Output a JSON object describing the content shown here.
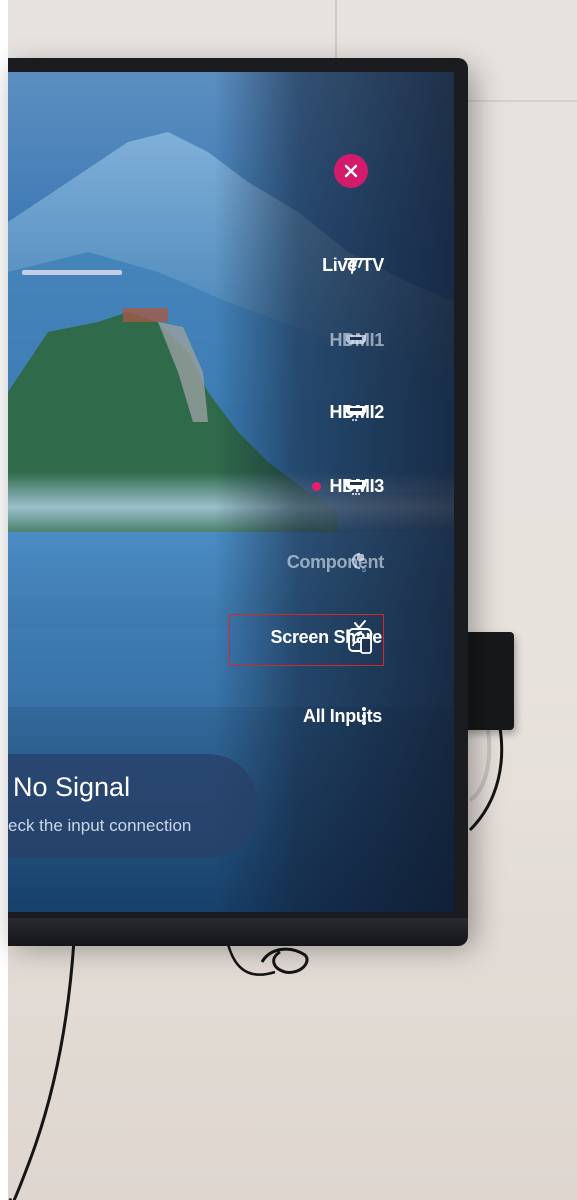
{
  "input_menu": {
    "close_label": "close",
    "items": [
      {
        "label": "Live TV",
        "icon": "antenna-icon",
        "active": false,
        "dimmed": false
      },
      {
        "label": "HDMI1",
        "icon": "hdmi-icon",
        "active": false,
        "dimmed": true
      },
      {
        "label": "HDMI2",
        "icon": "hdmi-icon",
        "active": false,
        "dimmed": false
      },
      {
        "label": "HDMI3",
        "icon": "hdmi-icon",
        "active": true,
        "dimmed": false
      },
      {
        "label": "Component",
        "icon": "component-icon",
        "active": false,
        "dimmed": true
      },
      {
        "label": "Screen Share",
        "icon": "screen-share-icon",
        "active": false,
        "dimmed": false,
        "highlighted": true
      },
      {
        "label": "All Inputs",
        "icon": "more-vertical-icon",
        "active": false,
        "dimmed": false
      }
    ]
  },
  "no_signal": {
    "title": "No Signal",
    "subtitle": "eck the input connection"
  },
  "colors": {
    "accent": "#d31b6b",
    "active_dot": "#e8206c",
    "highlight_box": "#d6252b",
    "menu_text": "#ffffff"
  }
}
